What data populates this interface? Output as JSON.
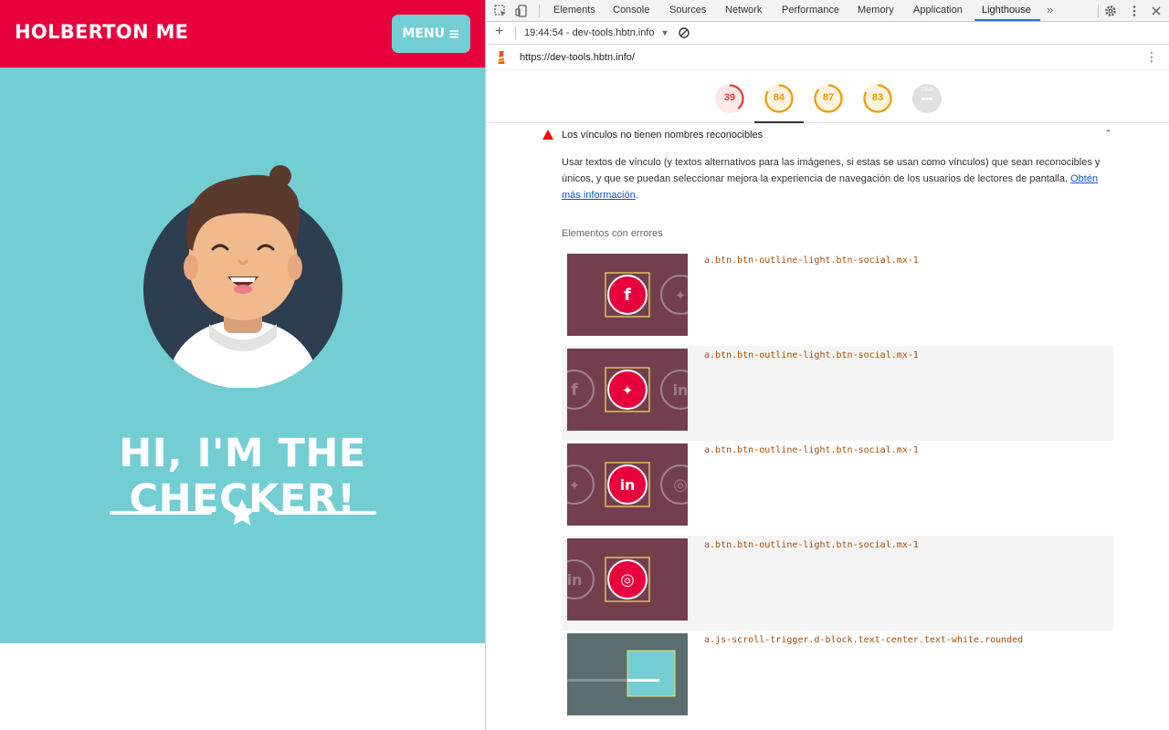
{
  "site": {
    "brand": "HOLBERTON ME",
    "menu_label": "MENU",
    "hero_title": "HI, I'M THE CHECKER!",
    "colors": {
      "nav": "#e8003d",
      "hero": "#73ced3",
      "avatar_bg": "#2c3e50"
    }
  },
  "devtools": {
    "tabs": [
      {
        "label": "Elements"
      },
      {
        "label": "Console"
      },
      {
        "label": "Sources"
      },
      {
        "label": "Network"
      },
      {
        "label": "Performance"
      },
      {
        "label": "Memory"
      },
      {
        "label": "Application"
      },
      {
        "label": "Lighthouse"
      }
    ],
    "active_tab": "Lighthouse",
    "more_tabs_glyph": "»",
    "icons": [
      "inspect-icon",
      "device-toolbar-icon",
      "settings-icon",
      "kebab-menu-icon"
    ],
    "lighthouse": {
      "report_select": "19:44:54 - dev-tools.hbtn.info",
      "url": "https://dev-tools.hbtn.info/",
      "gauges": [
        {
          "value": "39",
          "color": "#e53935",
          "bg": "#fde8e8"
        },
        {
          "value": "84",
          "color": "#f29900",
          "bg": "#fff3e0"
        },
        {
          "value": "87",
          "color": "#f29900",
          "bg": "#fff3e0"
        },
        {
          "value": "83",
          "color": "#f29900",
          "bg": "#fff3e0"
        },
        {
          "value": "PWA",
          "color": "#9e9e9e",
          "bg": "#e0e0e0"
        }
      ],
      "audit": {
        "title": "Los vínculos no tienen nombres reconocibles",
        "description": "Usar textos de vínculo (y textos alternativos para las imágenes, si estas se usan como vínculos) que sean reconocibles y únicos, y que se puedan seleccionar mejora la experiencia de navegación de los usuarios de lectores de pantalla.",
        "learn_more": "Obtén más información",
        "failing_label": "Elementos con errores",
        "items": [
          {
            "tag": "a",
            "selector": ".btn.btn-outline-light.btn-social.mx-1",
            "icon": "facebook-icon",
            "glyph": "f"
          },
          {
            "tag": "a",
            "selector": ".btn.btn-outline-light.btn-social.mx-1",
            "icon": "twitter-icon",
            "glyph": "t"
          },
          {
            "tag": "a",
            "selector": ".btn.btn-outline-light.btn-social.mx-1",
            "icon": "linkedin-icon",
            "glyph": "in"
          },
          {
            "tag": "a",
            "selector": ".btn.btn-outline-light.btn-social.mx-1",
            "icon": "dribbble-icon",
            "glyph": "d"
          },
          {
            "tag": "a",
            "selector": ".js-scroll-trigger.d-block.text-center.text-white.rounded",
            "icon": "scroll-trigger-icon",
            "glyph": ""
          }
        ]
      }
    }
  }
}
